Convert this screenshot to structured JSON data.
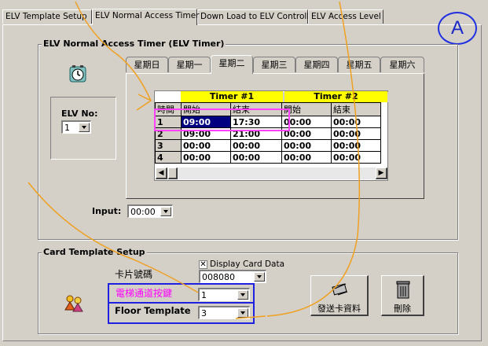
{
  "tabs": [
    "ELV Template Setup",
    "ELV Normal Access Timer",
    "Down Load to ELV Controller",
    "ELV Access Level"
  ],
  "active_tab": "ELV Normal Access Timer",
  "badge": "A",
  "timer_group": {
    "title": "ELV Normal Access Timer (ELV Timer)",
    "days": [
      "星期日",
      "星期一",
      "星期二",
      "星期三",
      "星期四",
      "星期五",
      "星期六"
    ],
    "active_day": "星期二",
    "elv_no_label": "ELV No:",
    "elv_no_value": "1",
    "timer1_header": "Timer #1",
    "timer2_header": "Timer #2",
    "col_time": "時間",
    "col_start": "開始",
    "col_end": "結束",
    "rows": [
      {
        "no": "1",
        "t1s": "09:00",
        "t1e": "17:30",
        "t2s": "00:00",
        "t2e": "00:00"
      },
      {
        "no": "2",
        "t1s": "09:00",
        "t1e": "21:00",
        "t2s": "00:00",
        "t2e": "00:00"
      },
      {
        "no": "3",
        "t1s": "00:00",
        "t1e": "00:00",
        "t2s": "00:00",
        "t2e": "00:00"
      },
      {
        "no": "4",
        "t1s": "00:00",
        "t1e": "00:00",
        "t2s": "00:00",
        "t2e": "00:00"
      }
    ],
    "input_label": "Input:",
    "input_value": "00:00"
  },
  "card_group": {
    "title": "Card Template Setup",
    "display_card_data": "Display Card Data",
    "card_no_label": "卡片號碼",
    "card_no_value": "008080",
    "elv_channel_label": "電梯通道按鍵",
    "elv_channel_value": "1",
    "floor_template_label": "Floor Template",
    "floor_template_value": "3",
    "send_button": "發送卡資料",
    "delete_button": "刪除"
  },
  "colors": {
    "timer_header": "#ffff00",
    "highlight_box": "#ff40ff",
    "label_box": "#2020e0",
    "annotation": "#f0a020",
    "selected_cell": "#000080"
  }
}
